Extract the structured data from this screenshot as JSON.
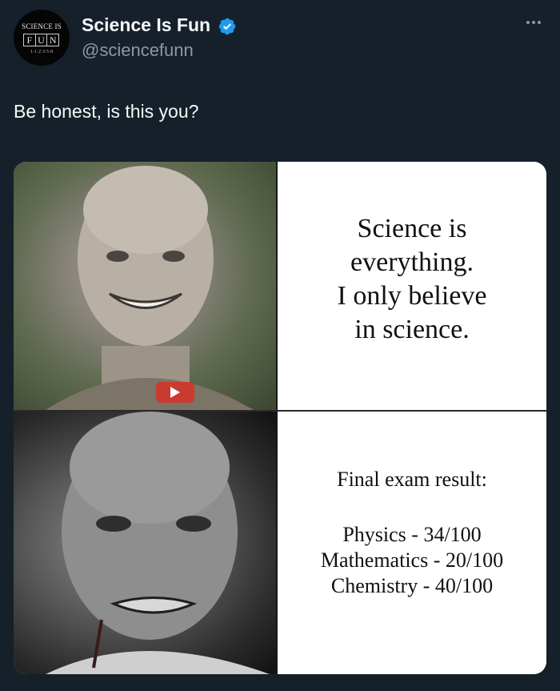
{
  "tweet": {
    "avatar": {
      "line1": "SCIENCE IS",
      "letters": [
        "F",
        "U",
        "N"
      ],
      "line3": "1·1·2·3·5·8"
    },
    "display_name": "Science Is Fun",
    "handle": "@sciencefunn",
    "verified_icon": "verified-badge-icon",
    "more_icon": "more-options-icon",
    "text": "Be honest, is this you?",
    "colors": {
      "background": "#15202b",
      "text": "#f7f9f9",
      "secondary": "#8b98a5",
      "verified": "#1d9bf0"
    }
  },
  "meme": {
    "top_caption": [
      "Science is",
      "everything.",
      "I only believe",
      "in science."
    ],
    "bottom_title": "Final exam result:",
    "results": [
      "Physics - 34/100",
      "Mathematics - 20/100",
      "Chemistry - 40/100"
    ]
  }
}
